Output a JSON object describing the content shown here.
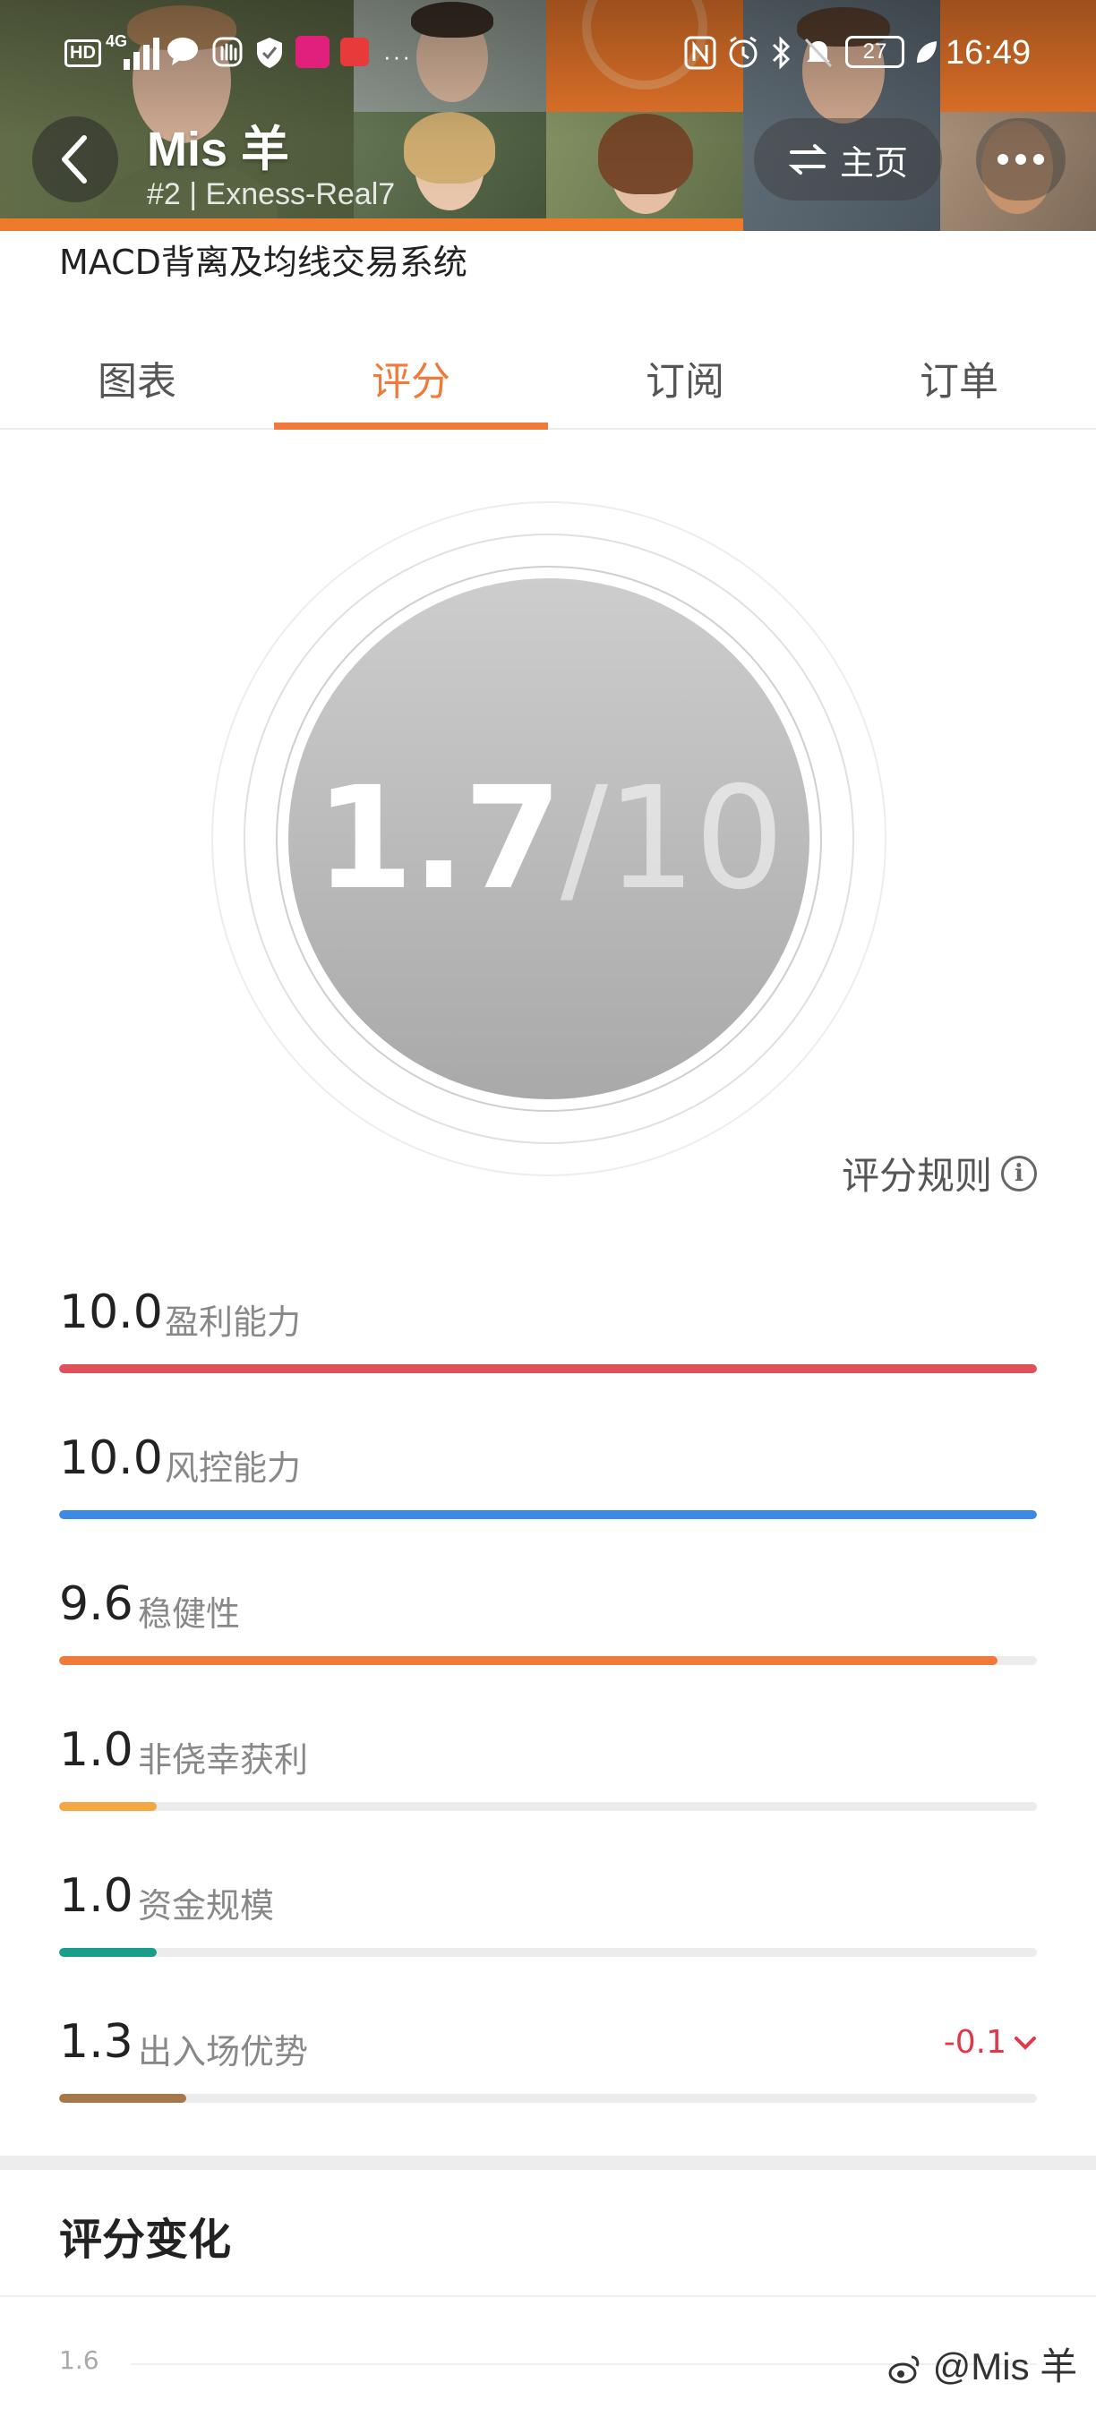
{
  "status_bar": {
    "left_icons": [
      "hd-icon",
      "signal-4g-icon",
      "wechat-icon",
      "hand-icon",
      "shield-icon",
      "app-icon",
      "book-icon",
      "more-dots-icon"
    ],
    "hd_label": "HD",
    "network_label": "4G",
    "battery": "27",
    "time": "16:49"
  },
  "header": {
    "title": "Mis 羊",
    "subtitle": "#2 | Exness-Real7",
    "home_label": "主页",
    "accent_color": "#f07a2c"
  },
  "strategy_name": "MACD背离及均线交易系统",
  "tabs": [
    {
      "label": "图表"
    },
    {
      "label": "评分"
    },
    {
      "label": "订阅"
    },
    {
      "label": "订单"
    }
  ],
  "active_tab": "评分",
  "score": {
    "value": "1.7",
    "denominator": "/10"
  },
  "rules_label": "评分规则",
  "metrics": [
    {
      "value": "10.0",
      "label": "盈利能力",
      "ratio": 1.0,
      "color": "#e0505a"
    },
    {
      "value": "10.0",
      "label": "风控能力",
      "ratio": 1.0,
      "color": "#3d8ae6"
    },
    {
      "value": "9.6",
      "label": "稳健性",
      "ratio": 0.96,
      "color": "#f07a3c"
    },
    {
      "value": "1.0",
      "label": "非侥幸获利",
      "ratio": 0.1,
      "color": "#f4a844"
    },
    {
      "value": "1.0",
      "label": "资金规模",
      "ratio": 0.1,
      "color": "#1a9e8c"
    },
    {
      "value": "1.3",
      "label": "出入场优势",
      "ratio": 0.13,
      "color": "#a8784a",
      "delta": "-0.1"
    }
  ],
  "section": {
    "title": "评分变化",
    "axis_first_tick": "1.6"
  },
  "watermark": "@Mis 羊"
}
